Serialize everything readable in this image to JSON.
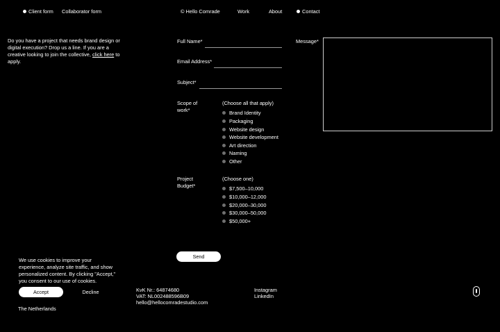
{
  "nav": {
    "client_form": "Client form",
    "collaborator_form": "Collaborator form",
    "brand": "© Hello Comrade",
    "work": "Work",
    "about": "About",
    "contact": "Contact"
  },
  "intro": {
    "text_before": "Do you have a project that needs brand design or digital execution? Drop us a line. If you are a creative looking to join the collective, ",
    "link": "click here",
    "text_after": " to apply."
  },
  "form": {
    "full_name_label": "Full Name*",
    "email_label": "Email Address*",
    "subject_label": "Subject*",
    "scope_label_1": "Scope of",
    "scope_label_2": "work*",
    "scope_hint": "(Choose all that apply)",
    "scope_options": [
      "Brand Identity",
      "Packaging",
      "Website design",
      "Website development",
      "Art direction",
      "Naming",
      "Other"
    ],
    "budget_label_1": "Project",
    "budget_label_2": "Budget*",
    "budget_hint": "(Choose one)",
    "budget_options": [
      "$7,500–10,000",
      "$10,000–12,000",
      "$20,000–30,000",
      "$30,000–50,000",
      "$50,000+"
    ],
    "message_label": "Message*",
    "send_label": "Send"
  },
  "cookie": {
    "text": "We use cookies to improve your experience, analyze site traffic, and show personalized content. By clicking \"Accept,\" you consent to our use of cookies.",
    "accept": "Accept",
    "decline": "Decline"
  },
  "footer": {
    "country": "The Netherlands",
    "kvk": "KvK Nr.: 64874680",
    "vat": "VAT: NL002488596B09",
    "email": "hello@hellocomradestudio.com",
    "instagram": "Instagram",
    "linkedin": "LinkedIn"
  }
}
